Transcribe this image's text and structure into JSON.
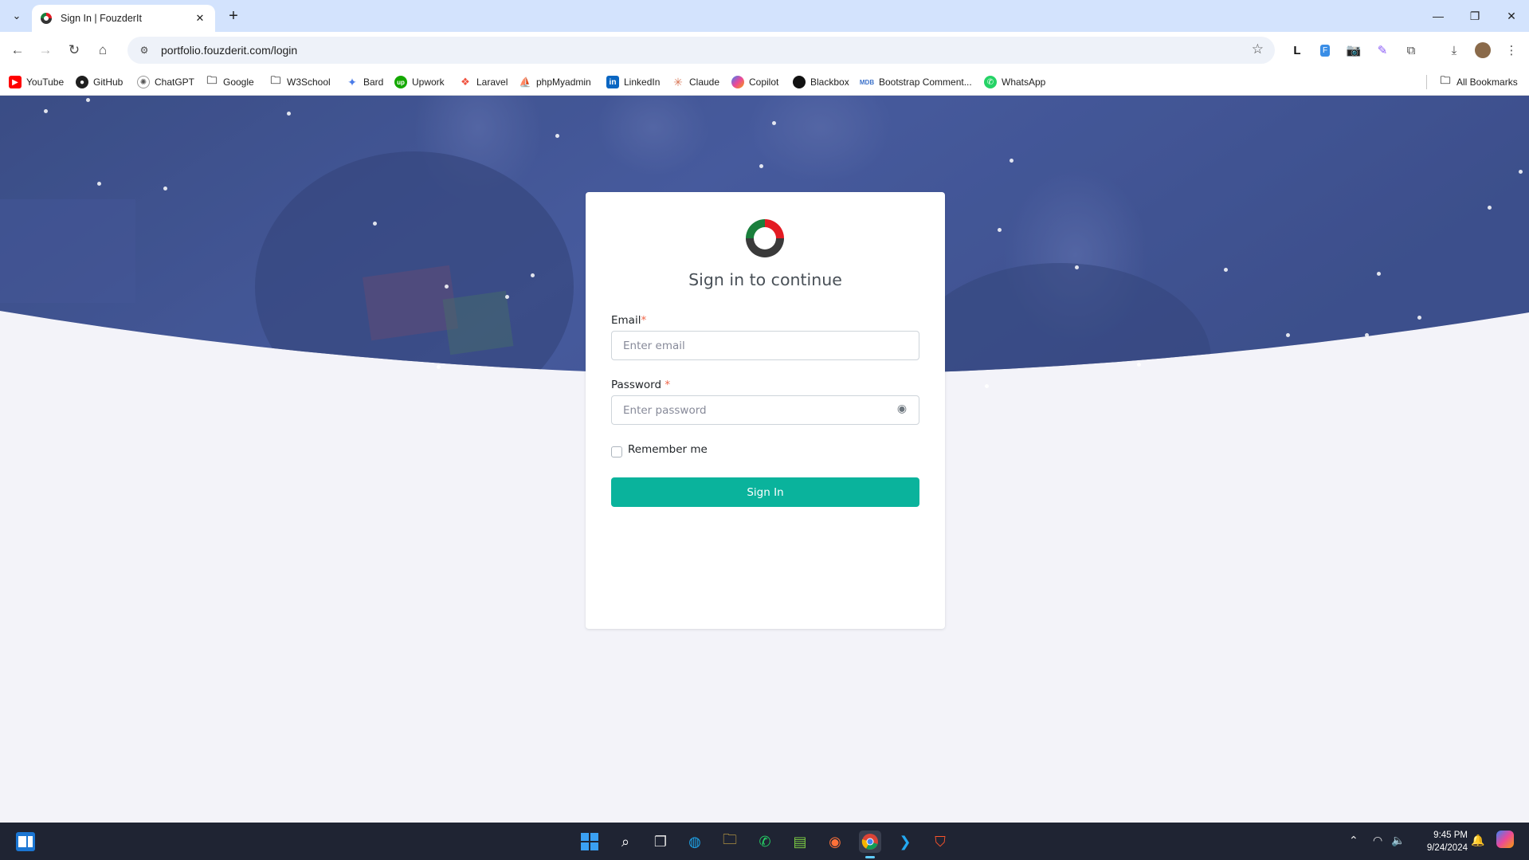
{
  "browser": {
    "tab_title": "Sign In | FouzderIt",
    "url": "portfolio.fouzderit.com/login",
    "bookmarks": [
      {
        "label": "YouTube",
        "icon": "youtube-icon",
        "color": "#ff0000"
      },
      {
        "label": "GitHub",
        "icon": "github-icon",
        "color": "#1f1f1f"
      },
      {
        "label": "ChatGPT",
        "icon": "chatgpt-icon",
        "color": "#555555"
      },
      {
        "label": "Google",
        "icon": "folder-icon",
        "color": "#474747"
      },
      {
        "label": "W3School",
        "icon": "folder-icon",
        "color": "#474747"
      },
      {
        "label": "Bard",
        "icon": "bard-icon",
        "color": "#4a7be8"
      },
      {
        "label": "Upwork",
        "icon": "upwork-icon",
        "color": "#14a800"
      },
      {
        "label": "Laravel",
        "icon": "laravel-icon",
        "color": "#f05340"
      },
      {
        "label": "phpMyadmin",
        "icon": "phpmyadmin-icon",
        "color": "#e8a23a"
      },
      {
        "label": "LinkedIn",
        "icon": "linkedin-icon",
        "color": "#0a66c2"
      },
      {
        "label": "Claude",
        "icon": "claude-icon",
        "color": "#d97757"
      },
      {
        "label": "Copilot",
        "icon": "copilot-icon",
        "color": "#3b82f6"
      },
      {
        "label": "Blackbox",
        "icon": "blackbox-icon",
        "color": "#111111"
      },
      {
        "label": "Bootstrap Comment...",
        "icon": "mdb-icon",
        "color": "#3b71ca"
      },
      {
        "label": "WhatsApp",
        "icon": "whatsapp-icon",
        "color": "#25d366"
      }
    ],
    "all_bookmarks": "All Bookmarks"
  },
  "login": {
    "title": "Sign in to continue",
    "email_label": "Email",
    "email_placeholder": "Enter email",
    "password_label": "Password",
    "password_placeholder": "Enter password",
    "required_mark": "*",
    "remember_label": "Remember me",
    "submit_label": "Sign In",
    "accent_color": "#0ab39c"
  },
  "taskbar": {
    "time": "9:45 PM",
    "date": "9/24/2024"
  }
}
